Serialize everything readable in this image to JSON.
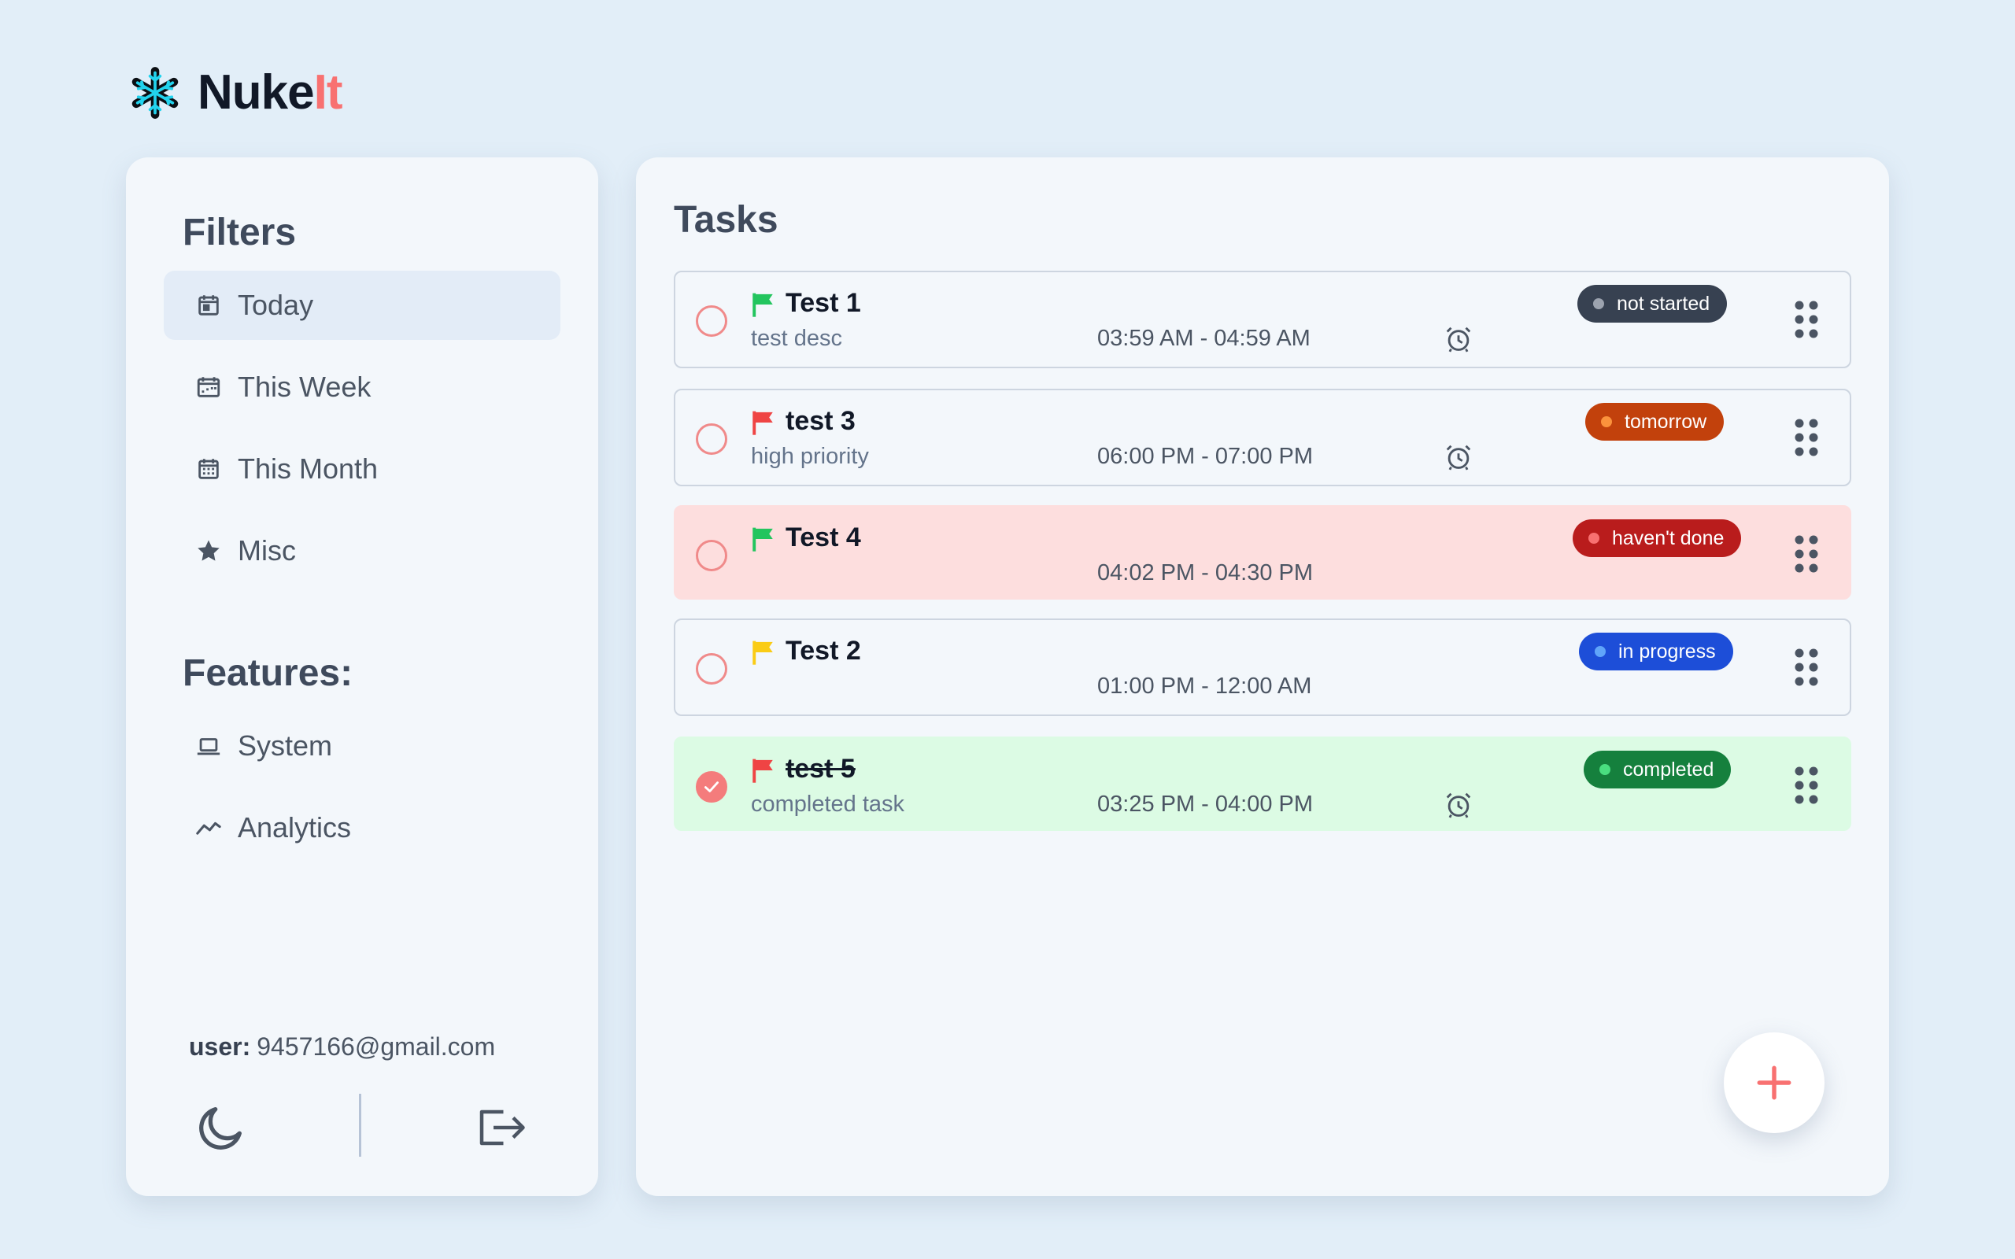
{
  "app": {
    "name_main": "Nuke",
    "name_accent": "It",
    "accent_color": "#f87171"
  },
  "sidebar": {
    "filters_title": "Filters",
    "filters": [
      {
        "label": "Today",
        "icon": "calendar-day-icon",
        "active": true
      },
      {
        "label": "This Week",
        "icon": "calendar-week-icon",
        "active": false
      },
      {
        "label": "This Month",
        "icon": "calendar-month-icon",
        "active": false
      },
      {
        "label": "Misc",
        "icon": "star-icon",
        "active": false
      }
    ],
    "features_title": "Features:",
    "features": [
      {
        "label": "System",
        "icon": "laptop-icon"
      },
      {
        "label": "Analytics",
        "icon": "trend-line-icon"
      }
    ],
    "user_label": "user:",
    "user_email": "9457166@gmail.com"
  },
  "main": {
    "title": "Tasks",
    "tasks": [
      {
        "title": "Test 1",
        "description": "test desc",
        "time": "03:59 AM - 04:59 AM",
        "flag_color": "#22c55e",
        "status": "not started",
        "status_bg": "#374151",
        "status_dot": "#9ca3af",
        "has_alarm": true,
        "completed": false
      },
      {
        "title": "test 3",
        "description": "high priority",
        "time": "06:00 PM - 07:00 PM",
        "flag_color": "#ef4444",
        "status": "tomorrow",
        "status_bg": "#c2410c",
        "status_dot": "#fb923c",
        "has_alarm": true,
        "completed": false
      },
      {
        "title": "Test 4",
        "description": "",
        "time": "04:02 PM - 04:30 PM",
        "flag_color": "#22c55e",
        "status": "haven't done",
        "status_bg": "#b91c1c",
        "status_dot": "#f87171",
        "has_alarm": false,
        "completed": false
      },
      {
        "title": "Test 2",
        "description": "",
        "time": "01:00 PM - 12:00 AM",
        "flag_color": "#facc15",
        "status": "in progress",
        "status_bg": "#1d4ed8",
        "status_dot": "#60a5fa",
        "has_alarm": false,
        "completed": false
      },
      {
        "title": "test 5",
        "description": "completed task",
        "time": "03:25 PM - 04:00 PM",
        "flag_color": "#ef4444",
        "status": "completed",
        "status_bg": "#15803d",
        "status_dot": "#4ade80",
        "has_alarm": true,
        "completed": true
      }
    ]
  }
}
